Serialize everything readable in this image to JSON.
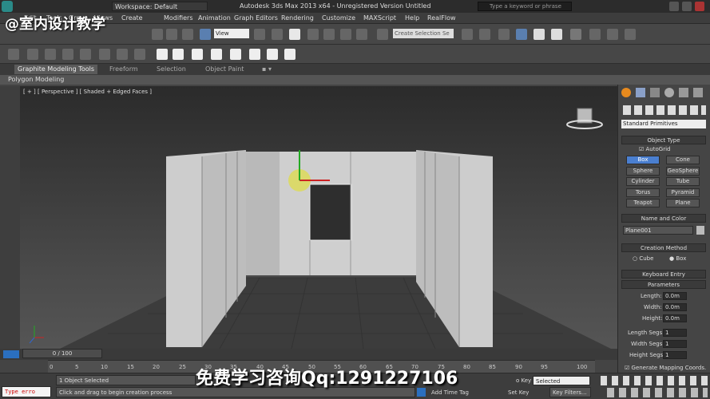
{
  "window": {
    "workspace_label": "Workspace: Default",
    "title": "Autodesk 3ds Max  2013 x64  -  Unregistered Version   Untitled",
    "search_placeholder": "Type a keyword or phrase"
  },
  "menu": [
    "Edit",
    "Tools",
    "Group",
    "Views",
    "Create",
    "Modifiers",
    "Animation",
    "Graph Editors",
    "Rendering",
    "Customize",
    "MAXScript",
    "Help",
    "RealFlow"
  ],
  "toolbar": {
    "view_select": "View",
    "selection_set_placeholder": "Create Selection Se"
  },
  "ribbon": {
    "tabs": [
      "Graphite Modeling Tools",
      "Freeform",
      "Selection",
      "Object Paint"
    ],
    "sub_tab": "Polygon Modeling"
  },
  "viewport": {
    "label": "[ + ] [ Perspective ] [ Shaded + Edged Faces ]"
  },
  "command_panel": {
    "category_select": "Standard Primitives",
    "object_type_header": "Object Type",
    "autogrid_label": "AutoGrid",
    "primitives": [
      "Box",
      "Cone",
      "Sphere",
      "GeoSphere",
      "Cylinder",
      "Tube",
      "Torus",
      "Pyramid",
      "Teapot",
      "Plane"
    ],
    "selected_primitive": "Box",
    "name_color_header": "Name and Color",
    "object_name": "Plane001",
    "creation_method_header": "Creation Method",
    "creation_options": [
      "Cube",
      "Box"
    ],
    "keyboard_entry_header": "Keyboard Entry",
    "parameters_header": "Parameters",
    "params": [
      {
        "label": "Length:",
        "value": "0.0m"
      },
      {
        "label": "Width:",
        "value": "0.0m"
      },
      {
        "label": "Height:",
        "value": "0.0m"
      },
      {
        "label": "Length Segs:",
        "value": "1"
      },
      {
        "label": "Width Segs:",
        "value": "1"
      },
      {
        "label": "Height Segs:",
        "value": "1"
      }
    ],
    "generate_mapping": "Generate Mapping Coords."
  },
  "timeline": {
    "frame_display": "0 / 100",
    "ruler_ticks": [
      "0",
      "5",
      "10",
      "15",
      "20",
      "25",
      "30",
      "35",
      "40",
      "45",
      "50",
      "55",
      "60",
      "65",
      "70",
      "75",
      "80",
      "85",
      "90",
      "95",
      "100"
    ]
  },
  "status": {
    "script_listener": "Type erro",
    "selection_status": "1 Object Selected",
    "prompt": "Click and drag to begin creation process",
    "add_time_tag": "Add Time Tag",
    "set_key": "Set Key",
    "key_filters": "Key Filters...",
    "key_mode": "Selected",
    "key_label": "o Key"
  },
  "watermarks": {
    "top": "@室内设计教学",
    "bottom": "免费学习咨询Qq:1291227106"
  }
}
